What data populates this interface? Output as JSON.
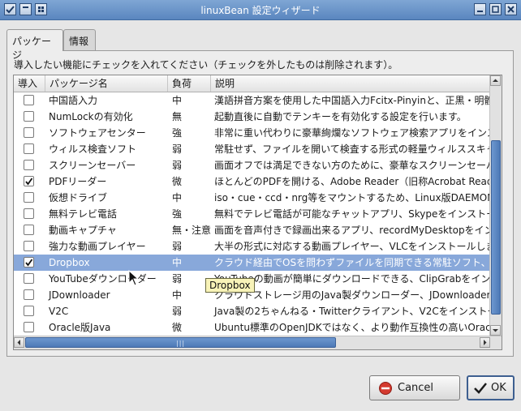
{
  "window": {
    "title": "linuxBean 設定ウィザード"
  },
  "tabs": [
    {
      "label": "パッケージ"
    },
    {
      "label": "情報"
    }
  ],
  "instruction": "導入したい機能にチェックを入れてください（チェックを外したものは削除されます）。",
  "table": {
    "headers": {
      "install": "導入",
      "name": "パッケージ名",
      "load": "負荷",
      "desc": "説明"
    },
    "rows": [
      {
        "checked": false,
        "name": "中国語入力",
        "load": "中",
        "desc": "漢語拼音方案を使用した中国語入力Fcitx-Pinyinと、正黒・明體"
      },
      {
        "checked": false,
        "name": "NumLockの有効化",
        "load": "無",
        "desc": "起動直後に自動でテンキーを有効化する設定を行います。"
      },
      {
        "checked": false,
        "name": "ソフトウェアセンター",
        "load": "強",
        "desc": "非常に重い代わりに豪華絢爛なソフトウェア検索アプリをインスト"
      },
      {
        "checked": false,
        "name": "ウィルス検査ソフト",
        "load": "弱",
        "desc": "常駐せず、ファイルを開いて検査する形式の軽量ウィルススキャナ"
      },
      {
        "checked": false,
        "name": "スクリーンセーバー",
        "load": "弱",
        "desc": "画面オフでは満足できない方のために、豪華なスクリーンセーバー"
      },
      {
        "checked": true,
        "name": "PDFリーダー",
        "load": "微",
        "desc": "ほとんどのPDFを開ける、Adobe Reader（旧称Acrobat Reader"
      },
      {
        "checked": false,
        "name": "仮想ドライブ",
        "load": "中",
        "desc": "iso・cue・ccd・nrg等をマウントするため、Linux版DAEMON To"
      },
      {
        "checked": false,
        "name": "無料テレビ電話",
        "load": "強",
        "desc": "無料でテレビ電話が可能なチャットアプリ、Skypeをインストールし"
      },
      {
        "checked": false,
        "name": "動画キャプチャ",
        "load": "無・注意",
        "desc": "画面を音声付きで録画出来るアプリ、recordMyDesktopをインス"
      },
      {
        "checked": false,
        "name": "強力な動画プレイヤー",
        "load": "弱",
        "desc": "大半の形式に対応する動画プレイヤー、VLCをインストールします"
      },
      {
        "checked": true,
        "name": "Dropbox",
        "load": "中",
        "desc": "クラウド経由でOSを問わずファイルを同期できる常駐ソフト、Drop",
        "selected": true
      },
      {
        "checked": false,
        "name": "YouTubeダウンローダー",
        "load": "弱",
        "desc": "YouTubeの動画が簡単にダウンロードできる、ClipGrabをインス"
      },
      {
        "checked": false,
        "name": "JDownloader",
        "load": "中",
        "desc": "クラウドストレージ用のJava製ダウンローダー、JDownloaderをイ"
      },
      {
        "checked": false,
        "name": "V2C",
        "load": "弱",
        "desc": "Java製の2ちゃんねる・Twitterクライアント、V2Cをインストールし"
      },
      {
        "checked": false,
        "name": "Oracle版Java",
        "load": "微",
        "desc": "Ubuntu標準のOpenJDKではなく、より動作互換性の高いOracle"
      }
    ]
  },
  "tooltip": {
    "text": "Dropbox"
  },
  "buttons": {
    "cancel": "Cancel",
    "ok": "OK"
  },
  "colors": {
    "selection": "#88a8da",
    "titlebar": "#5a86bf",
    "tooltip": "#f8f3b8"
  }
}
